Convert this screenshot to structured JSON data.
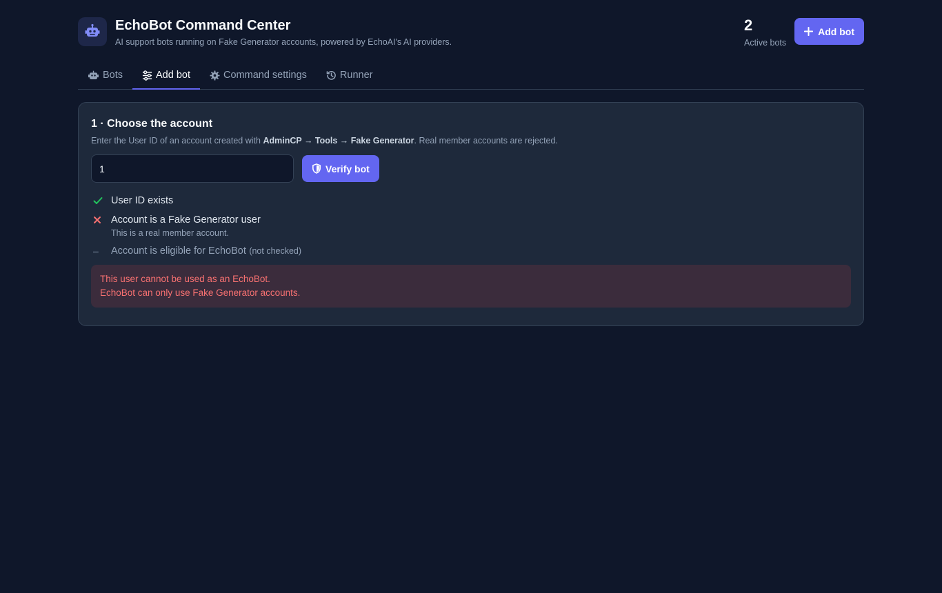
{
  "header": {
    "title": "EchoBot Command Center",
    "subtitle": "AI support bots running on Fake Generator accounts, powered by EchoAI's AI providers.",
    "logo_icon": "robot-icon",
    "stat_value": "2",
    "stat_label": "Active bots",
    "add_bot_label": "Add bot"
  },
  "tabs": [
    {
      "label": "Bots",
      "icon": "robot-icon",
      "active": false
    },
    {
      "label": "Add bot",
      "icon": "sliders-icon",
      "active": true
    },
    {
      "label": "Command settings",
      "icon": "gear-icon",
      "active": false
    },
    {
      "label": "Runner",
      "icon": "history-icon",
      "active": false
    }
  ],
  "step": {
    "title": "1 · Choose the account",
    "desc_prefix": "Enter the User ID of an account created with ",
    "desc_path_1": "AdminCP",
    "desc_arrow_1": " → ",
    "desc_path_2": "Tools",
    "desc_arrow_2": " → ",
    "desc_path_3": "Fake Generator",
    "desc_suffix": ". Real member accounts are rejected.",
    "input_value": "1",
    "verify_label": "Verify bot"
  },
  "checks": [
    {
      "status": "pass",
      "label": "User ID exists"
    },
    {
      "status": "fail",
      "label": "Account is a Fake Generator user",
      "note": "This is a real member account."
    },
    {
      "status": "skipped",
      "label": "Account is eligible for EchoBot",
      "suffix": "(not checked)"
    }
  ],
  "alert": {
    "line1": "This user cannot be used as an EchoBot.",
    "line2": "EchoBot can only use Fake Generator accounts."
  },
  "colors": {
    "background": "#0f172a",
    "card": "#1e293b",
    "accent": "#6366f1",
    "success": "#22c55e",
    "error": "#f87171"
  }
}
